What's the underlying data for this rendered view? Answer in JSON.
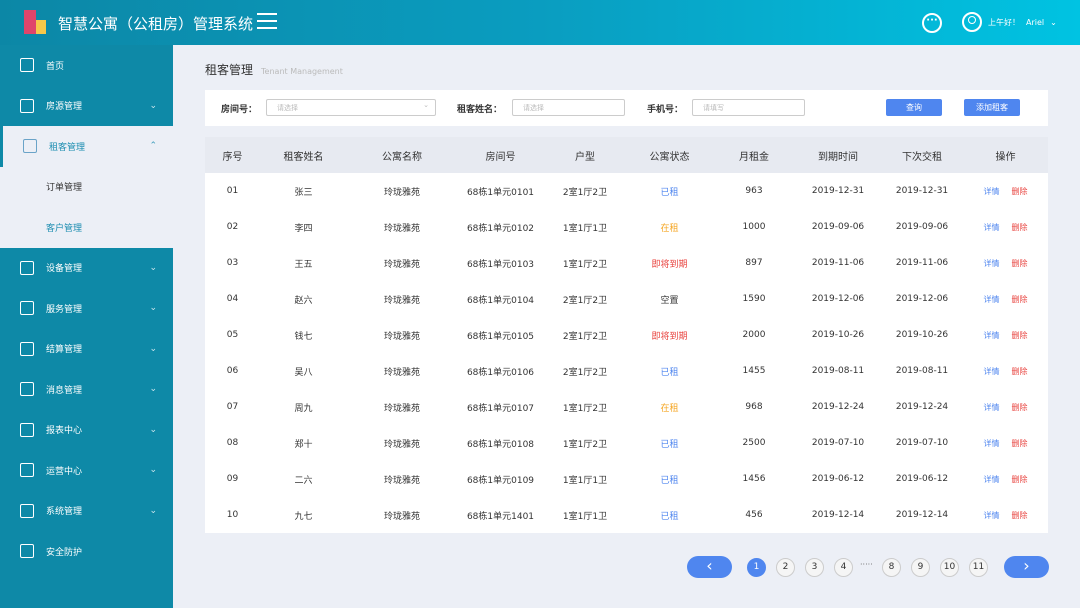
{
  "header": {
    "title": "智慧公寓（公租房）管理系统",
    "greeting": "上午好！",
    "user": "Ariel"
  },
  "sidebar": {
    "items": [
      {
        "label": "首页",
        "icon": "home-icon"
      },
      {
        "label": "房源管理",
        "icon": "house-list-icon"
      },
      {
        "label": "租客管理",
        "icon": "home-icon"
      },
      {
        "label": "设备管理",
        "icon": "device-icon"
      },
      {
        "label": "服务管理",
        "icon": "tools-icon"
      },
      {
        "label": "结算管理",
        "icon": "document-icon"
      },
      {
        "label": "消息管理",
        "icon": "message-icon"
      },
      {
        "label": "报表中心",
        "icon": "report-icon"
      },
      {
        "label": "运营中心",
        "icon": "monitor-icon"
      },
      {
        "label": "系统管理",
        "icon": "gear-icon"
      },
      {
        "label": "安全防护",
        "icon": "shield-icon"
      }
    ],
    "sub_items": [
      "订单管理",
      "客户管理"
    ]
  },
  "page": {
    "title": "租客管理",
    "subtitle": "Tenant Management"
  },
  "filter": {
    "room_label": "房间号：",
    "room_placeholder": "请选择",
    "name_label": "租客姓名：",
    "name_placeholder": "请选择",
    "phone_label": "手机号：",
    "phone_placeholder": "请填写",
    "search": "查询",
    "add": "添加租客"
  },
  "table": {
    "headers": [
      "序号",
      "租客姓名",
      "公寓名称",
      "房间号",
      "户型",
      "公寓状态",
      "月租金",
      "到期时间",
      "下次交租",
      "操作"
    ],
    "detail": "详情",
    "delete": "删除",
    "rows": [
      [
        "01",
        "张三",
        "玲珑雅苑",
        "68栋1单元0101",
        "2室1厅2卫",
        "已租",
        "963",
        "2019-12-31",
        "2019-12-31"
      ],
      [
        "02",
        "李四",
        "玲珑雅苑",
        "68栋1单元0102",
        "1室1厅1卫",
        "在租",
        "1000",
        "2019-09-06",
        "2019-09-06"
      ],
      [
        "03",
        "王五",
        "玲珑雅苑",
        "68栋1单元0103",
        "1室1厅2卫",
        "即将到期",
        "897",
        "2019-11-06",
        "2019-11-06"
      ],
      [
        "04",
        "赵六",
        "玲珑雅苑",
        "68栋1单元0104",
        "2室1厅2卫",
        "空置",
        "1590",
        "2019-12-06",
        "2019-12-06"
      ],
      [
        "05",
        "钱七",
        "玲珑雅苑",
        "68栋1单元0105",
        "2室1厅2卫",
        "即将到期",
        "2000",
        "2019-10-26",
        "2019-10-26"
      ],
      [
        "06",
        "吴八",
        "玲珑雅苑",
        "68栋1单元0106",
        "2室1厅2卫",
        "已租",
        "1455",
        "2019-08-11",
        "2019-08-11"
      ],
      [
        "07",
        "周九",
        "玲珑雅苑",
        "68栋1单元0107",
        "1室1厅2卫",
        "在租",
        "968",
        "2019-12-24",
        "2019-12-24"
      ],
      [
        "08",
        "郑十",
        "玲珑雅苑",
        "68栋1单元0108",
        "1室1厅2卫",
        "已租",
        "2500",
        "2019-07-10",
        "2019-07-10"
      ],
      [
        "09",
        "二六",
        "玲珑雅苑",
        "68栋1单元0109",
        "1室1厅1卫",
        "已租",
        "1456",
        "2019-06-12",
        "2019-06-12"
      ],
      [
        "10",
        "九七",
        "玲珑雅苑",
        "68栋1单元1401",
        "1室1厅1卫",
        "已租",
        "456",
        "2019-12-14",
        "2019-12-14"
      ]
    ]
  },
  "status_colors": {
    "已租": "#4f86ef",
    "在租": "#f5a623",
    "即将到期": "#e8433f",
    "空置": "#333333"
  },
  "pagination": {
    "pages": [
      "1",
      "2",
      "3",
      "4",
      "8",
      "9",
      "10",
      "11"
    ],
    "ellipsis": "·····",
    "current": "1"
  }
}
